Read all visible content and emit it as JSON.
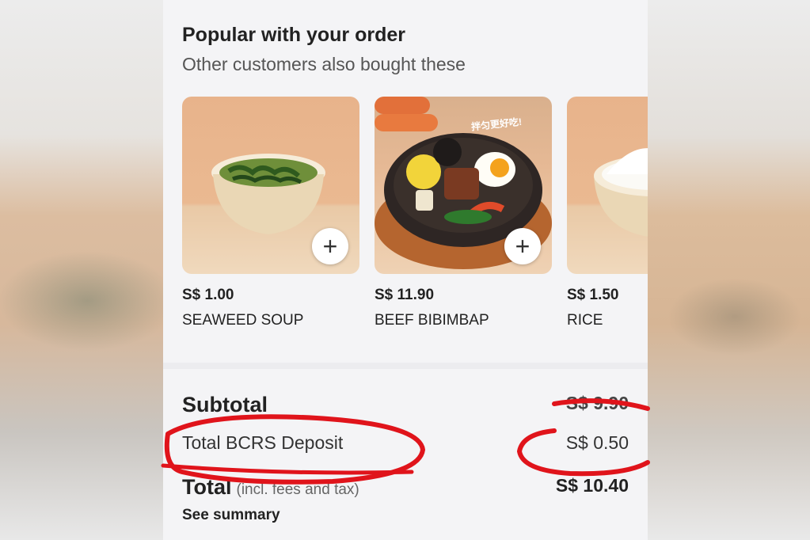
{
  "section": {
    "title": "Popular with your order",
    "subtitle": "Other customers also bought these"
  },
  "products": [
    {
      "price": "S$ 1.00",
      "name": "SEAWEED SOUP",
      "add_label": "+"
    },
    {
      "price": "S$ 11.90",
      "name": "BEEF BIBIMBAP",
      "add_label": "+",
      "image_caption": "拌匀更好吃!"
    },
    {
      "price": "S$ 1.50",
      "name": "RICE"
    }
  ],
  "summary": {
    "subtotal_label": "Subtotal",
    "subtotal_value": "S$ 9.90",
    "deposit_label": "Total BCRS Deposit",
    "deposit_value": "S$ 0.50",
    "total_label": "Total",
    "total_note": "(incl. fees and tax)",
    "total_value": "S$ 10.40",
    "see_summary": "See summary"
  },
  "colors": {
    "annotation": "#e0141b",
    "card_background": "#e8b38b"
  }
}
